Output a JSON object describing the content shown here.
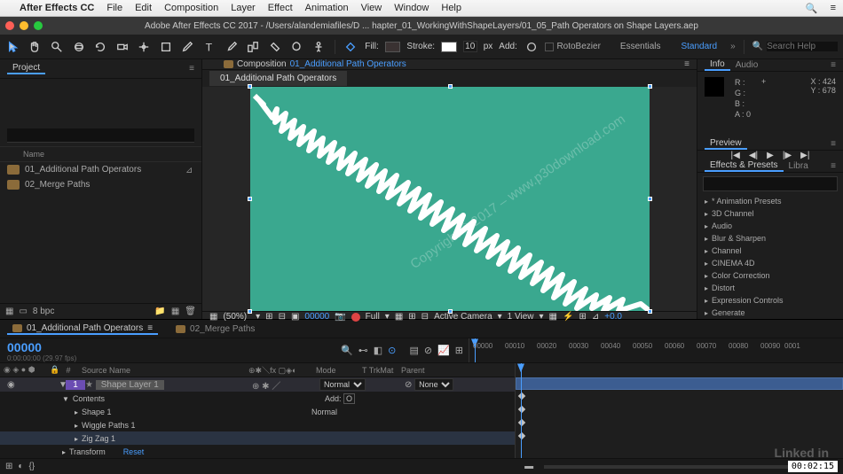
{
  "menubar": {
    "app": "After Effects CC",
    "items": [
      "File",
      "Edit",
      "Composition",
      "Layer",
      "Effect",
      "Animation",
      "View",
      "Window",
      "Help"
    ]
  },
  "titlebar": "Adobe After Effects CC 2017 - /Users/alandemiafiles/D ... hapter_01_WorkingWithShapeLayers/01_05_Path Operators on Shape Layers.aep",
  "toolbar": {
    "fill_label": "Fill:",
    "stroke_label": "Stroke:",
    "stroke_px": "10",
    "px_label": "px",
    "add_label": "Add:",
    "rotobez": "RotoBezier",
    "ws_essentials": "Essentials",
    "ws_standard": "Standard",
    "search_help_ph": "Search Help"
  },
  "project": {
    "title": "Project",
    "name_col": "Name",
    "items": [
      "01_Additional Path Operators",
      "02_Merge Paths"
    ],
    "search_ph": ""
  },
  "comp": {
    "prefix": "Composition",
    "name": "01_Additional Path Operators",
    "subtab": "01_Additional Path Operators",
    "footer": {
      "zoom": "(50%)",
      "time": "00000",
      "quality": "Full",
      "camera": "Active Camera",
      "views": "1 View",
      "expo": "+0.0"
    }
  },
  "info": {
    "title": "Info",
    "audio": "Audio",
    "r": "R :",
    "g": "G :",
    "b": "B :",
    "a": "A : 0",
    "x": "X : 424",
    "y": "Y : 678"
  },
  "preview": {
    "title": "Preview"
  },
  "effects": {
    "title": "Effects & Presets",
    "libra": "Libra",
    "items": [
      "* Animation Presets",
      "3D Channel",
      "Audio",
      "Blur & Sharpen",
      "Channel",
      "CINEMA 4D",
      "Color Correction",
      "Distort",
      "Expression Controls",
      "Generate"
    ]
  },
  "timeline": {
    "tab1": "01_Additional Path Operators",
    "tab2": "02_Merge Paths",
    "timecode": "00000",
    "frac": "0:00:00:00 (29.97 fps)",
    "ruler": [
      "00000",
      "00010",
      "00020",
      "00030",
      "00040",
      "00050",
      "00060",
      "00070",
      "00080",
      "00090",
      "0001"
    ],
    "headers": {
      "src": "Source Name",
      "mode": "Mode",
      "trk": "TrkMat",
      "parent": "Parent",
      "num": "#"
    },
    "layer": {
      "num": "1",
      "name": "Shape Layer 1",
      "mode": "Normal",
      "parent": "None",
      "contents": "Contents",
      "shape1": "Shape 1",
      "shape1_mode": "Normal",
      "wiggle": "Wiggle Paths 1",
      "zigzag": "Zig Zag 1",
      "transform": "Transform",
      "reset": "Reset",
      "add": "Add:"
    }
  },
  "footer": {
    "bpc": "8 bpc"
  },
  "watermark": {
    "diag": "Copyright © 2017 – www.p30download.com",
    "li": "Linked in"
  },
  "timestamp": "00:02:15"
}
